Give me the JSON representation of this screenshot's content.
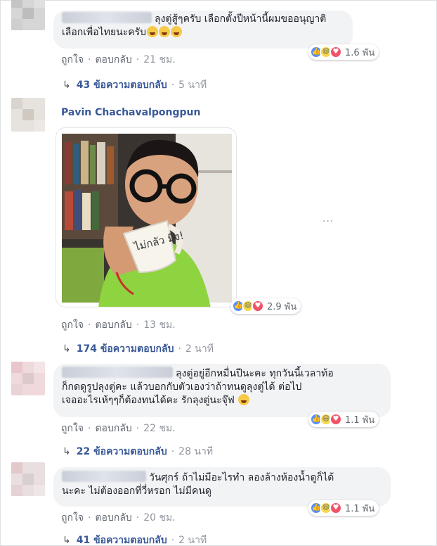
{
  "actions": {
    "like": "ถูกใจ",
    "reply": "ตอบกลับ",
    "sep": "·"
  },
  "comments": [
    {
      "name": "Sichai Pattama",
      "name_blurred": true,
      "text_line1": "ลุงตู่สู้ๆครับ เลือกตั้งปีหน้านี้ผมขออนุญาติ",
      "text_line2": "เลือกเพื่อไทยนะครับ",
      "emoji": "grinning-face",
      "time": "21 ชม.",
      "reaction_count": "1.6 พัน",
      "reaction_icons": [
        "like-icon",
        "haha-icon",
        "love-icon"
      ],
      "replies": "43 ข้อความตอบกลับ",
      "reply_time": "5 นาที"
    },
    {
      "name": "Pavin Chachavalpongpun",
      "name_blurred": false,
      "image": "photo-man-drinking-from-mug",
      "mug_text": "ไม่กลัว มึง!",
      "time": "13 ชม.",
      "reaction_count": "2.9 พัน",
      "reaction_icons": [
        "like-icon",
        "haha-icon",
        "love-icon"
      ],
      "replies": "174 ข้อความตอบกลับ",
      "reply_time": "2 นาที"
    },
    {
      "name": "Supha Nipat",
      "name_blurred": true,
      "text_line1": "ลุงตู่อยู่อีกหมื่นปีนะคะ ทุกวันนี้เวลาท้อ",
      "text_line2": "ก็กดดูรูปลุงตู่คะ แล้วบอกกับตัวเองว่าถ้าทนดูลุงตู่ได้ ต่อไป",
      "text_line3": "เจออะไรเห้ๆๆก็ต้องทนได้คะ รักลุงตู่นะจุ๊ฟ",
      "emoji": "winking-face",
      "time": "22 ชม.",
      "reaction_count": "1.1 พัน",
      "reaction_icons": [
        "like-icon",
        "haha-icon",
        "love-icon"
      ],
      "replies": "22 ข้อความตอบกลับ",
      "reply_time": "28 นาที"
    },
    {
      "name": "วันศุกร์",
      "name_blurred": true,
      "text_line1": "วันศุกร์ ถ้าไม่มีอะไรทำ ลองล้างห้องน้ำดูก็ได้",
      "text_line2": "นะคะ ไม่ต้องออกที่วี่หรอก ไม่มีคนดู",
      "time": "20 ชม.",
      "reaction_count": "1.1 พัน",
      "reaction_icons": [
        "like-icon",
        "haha-icon",
        "love-icon"
      ],
      "replies": "41 ข้อความตอบกลับ",
      "reply_time": "2 นาที"
    }
  ],
  "more_options": "···",
  "colors": {
    "link": "#385898",
    "bubble": "#f2f3f5",
    "meta": "#616770"
  }
}
